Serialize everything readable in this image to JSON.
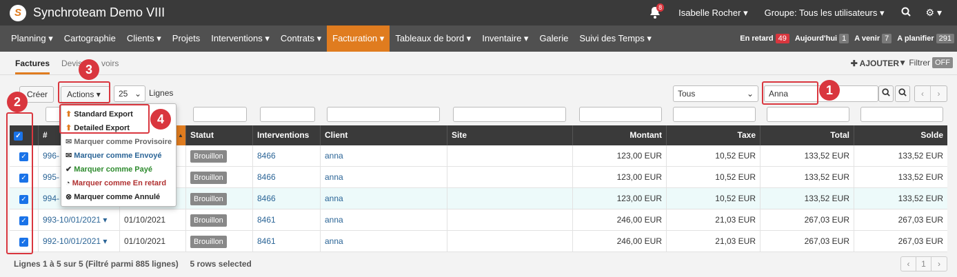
{
  "app": {
    "title": "Synchroteam Demo VIII",
    "logo": "S",
    "notif_count": "8",
    "user": "Isabelle Rocher",
    "group": "Groupe: Tous les utilisateurs"
  },
  "menu": [
    {
      "label": "Planning"
    },
    {
      "label": "Cartographie"
    },
    {
      "label": "Clients"
    },
    {
      "label": "Projets"
    },
    {
      "label": "Interventions"
    },
    {
      "label": "Contrats"
    },
    {
      "label": "Facturation"
    },
    {
      "label": "Tableaux de bord"
    },
    {
      "label": "Inventaire"
    },
    {
      "label": "Galerie"
    },
    {
      "label": "Suivi des Temps"
    }
  ],
  "counters": [
    {
      "label": "En retard",
      "value": "49"
    },
    {
      "label": "Aujourd'hui",
      "value": "1"
    },
    {
      "label": "A venir",
      "value": "7"
    },
    {
      "label": "A planifier",
      "value": "291"
    }
  ],
  "subtabs": {
    "factures": "Factures",
    "devis": "Devis",
    "avoirs": "voirs"
  },
  "actions_bar": {
    "ajouter": "AJOUTER",
    "filtrer": "Filtrer",
    "filtrer_state": "OFF",
    "creer": "Créer",
    "actions": "Actions",
    "page_size": "25",
    "lignes": "Lignes",
    "status_filter": "Tous",
    "search_value": "Anna"
  },
  "dropdown": [
    {
      "label": "Standard Export",
      "color": "#222222"
    },
    {
      "label": "Detailed Export",
      "color": "#222222"
    },
    {
      "label": "Marquer comme Provisoire",
      "color": "#666666"
    },
    {
      "label": "Marquer comme Envoyé",
      "color": "#2a6496"
    },
    {
      "label": "Marquer comme Payé",
      "color": "#2e8b2e"
    },
    {
      "label": "Marquer comme En retard",
      "color": "#b03030"
    },
    {
      "label": "Marquer comme Annulé",
      "color": "#222222"
    }
  ],
  "columns": {
    "num": "#",
    "statut": "Statut",
    "interventions": "Interventions",
    "client": "Client",
    "site": "Site",
    "montant": "Montant",
    "taxe": "Taxe",
    "total": "Total",
    "solde": "Solde"
  },
  "rows": [
    {
      "num": "996-",
      "date": "",
      "statut": "Brouillon",
      "interv": "8466",
      "client": "anna",
      "montant": "123,00 EUR",
      "taxe": "10,52 EUR",
      "total": "133,52 EUR",
      "solde": "133,52 EUR"
    },
    {
      "num": "995-",
      "date": "",
      "statut": "Brouillon",
      "interv": "8466",
      "client": "anna",
      "montant": "123,00 EUR",
      "taxe": "10,52 EUR",
      "total": "133,52 EUR",
      "solde": "133,52 EUR"
    },
    {
      "num": "994-",
      "date": "",
      "statut": "Brouillon",
      "interv": "8466",
      "client": "anna",
      "montant": "123,00 EUR",
      "taxe": "10,52 EUR",
      "total": "133,52 EUR",
      "solde": "133,52 EUR"
    },
    {
      "num": "993-10/01/2021",
      "date": "01/10/2021",
      "statut": "Brouillon",
      "interv": "8461",
      "client": "anna",
      "montant": "246,00 EUR",
      "taxe": "21,03 EUR",
      "total": "267,03 EUR",
      "solde": "267,03 EUR"
    },
    {
      "num": "992-10/01/2021",
      "date": "01/10/2021",
      "statut": "Brouillon",
      "interv": "8461",
      "client": "anna",
      "montant": "246,00 EUR",
      "taxe": "21,03 EUR",
      "total": "267,03 EUR",
      "solde": "267,03 EUR"
    }
  ],
  "footer": {
    "lines": "Lignes 1 à 5 sur 5 (Filtré parmi 885 lignes)",
    "selected": "5 rows selected",
    "page": "1"
  },
  "callouts": [
    "1",
    "2",
    "3",
    "4"
  ],
  "colors": {
    "accent": "#e07c1f",
    "callout": "#d9363e",
    "dark": "#3a3a3a"
  }
}
